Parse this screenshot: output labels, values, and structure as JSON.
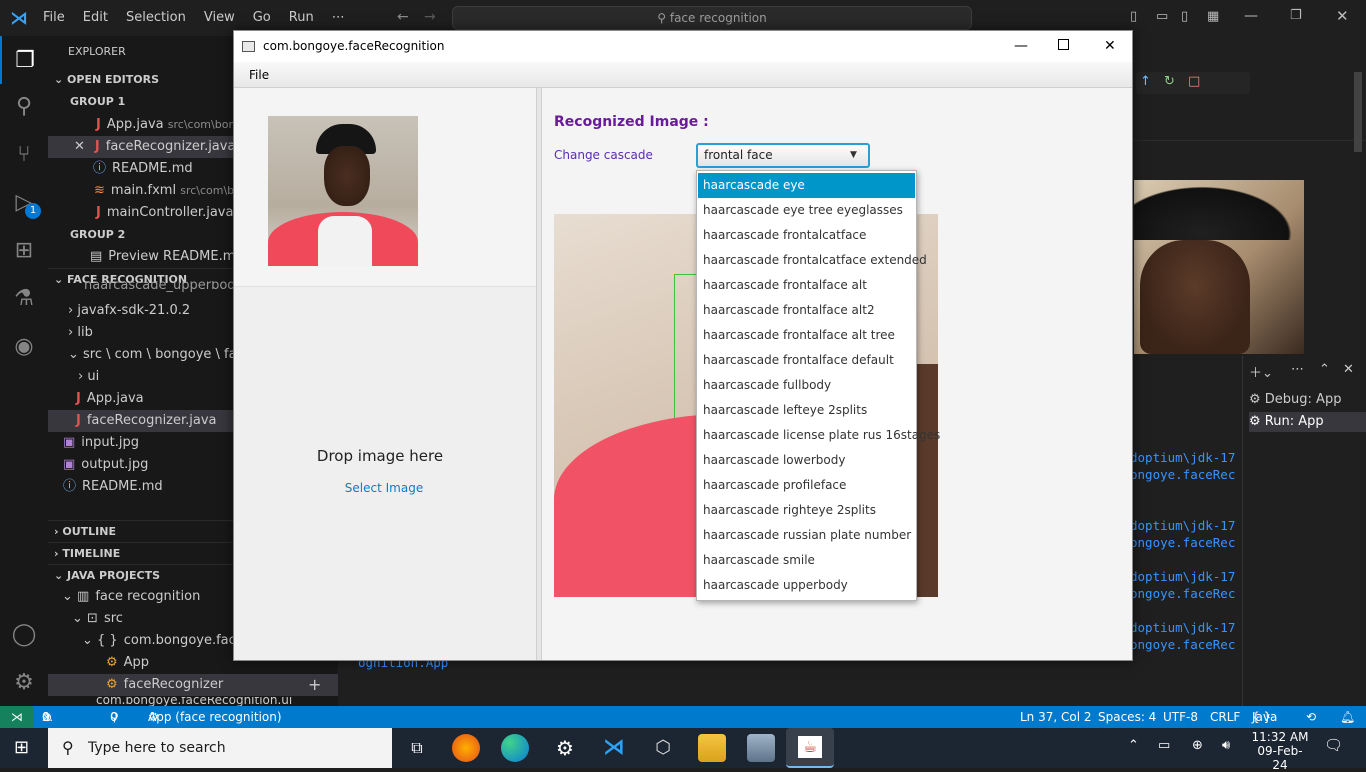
{
  "vscode": {
    "menu": [
      "File",
      "Edit",
      "Selection",
      "View",
      "Go",
      "Run",
      "⋯"
    ],
    "command_center": "face recognition",
    "debug_badge": "1"
  },
  "sidebar": {
    "explorer_title": "EXPLORER",
    "open_editors": "OPEN EDITORS",
    "group1": "GROUP 1",
    "group2": "GROUP 2",
    "open_files": [
      {
        "name": "App.java",
        "path": "src\\com\\bon"
      },
      {
        "name": "faceRecognizer.java",
        "path": "s"
      },
      {
        "name": "README.md",
        "path": ""
      },
      {
        "name": "main.fxml",
        "path": "src\\com\\bo"
      },
      {
        "name": "mainController.java",
        "path": "s"
      }
    ],
    "preview_readme": "Preview README.md",
    "project": "FACE RECOGNITION",
    "tree": {
      "cut_item": "haarcascade_upperbody.",
      "javafx": "javafx-sdk-21.0.2",
      "lib": "lib",
      "src_path": "src \\ com \\ bongoye \\ faceRe",
      "ui": "ui",
      "app_java": "App.java",
      "face_java": "faceRecognizer.java",
      "input": "input.jpg",
      "output": "output.jpg",
      "readme": "README.md"
    },
    "outline": "OUTLINE",
    "timeline": "TIMELINE",
    "java_projects": "JAVA PROJECTS",
    "jp_root": "face recognition",
    "jp_src": "src",
    "jp_pkg": "com.bongoye.faceR",
    "jp_app": "App",
    "jp_face": "faceRecognizer",
    "jp_cut": "com.bongoye.faceRecognition.ui"
  },
  "panel": {
    "debug_app": "Debug: App",
    "run_app": "Run: App",
    "lines": [
      "doptium\\jdk-17",
      "ongoye.faceRec",
      "doptium\\jdk-17",
      "ongoye.faceRec",
      "doptium\\jdk-17",
      "ongoye.faceRec",
      "doptium\\jdk-17",
      "ongoye.faceRec"
    ],
    "bottom_line": "ognition.App"
  },
  "statusbar": {
    "errors": "0",
    "warnings": "0",
    "ports": "0",
    "run_target": "App (face recognition)",
    "position": "Ln 37, Col 2",
    "spaces": "Spaces: 4",
    "encoding": "UTF-8",
    "eol": "CRLF",
    "language": "Java"
  },
  "taskbar": {
    "search_placeholder": "Type here to search",
    "time": "11:32 AM",
    "date": "09-Feb-24"
  },
  "fx": {
    "title": "com.bongoye.faceRecognition",
    "menu_file": "File",
    "drop_label": "Drop image here",
    "select_image": "Select Image",
    "recognized_title": "Recognized Image :",
    "change_cascade": "Change cascade",
    "cascade_value": "frontal face",
    "options": [
      "haarcascade eye",
      "haarcascade eye tree eyeglasses",
      "haarcascade frontalcatface",
      "haarcascade frontalcatface extended",
      "haarcascade frontalface alt",
      "haarcascade frontalface alt2",
      "haarcascade frontalface alt tree",
      "haarcascade frontalface default",
      "haarcascade fullbody",
      "haarcascade lefteye 2splits",
      "haarcascade license plate rus 16stages",
      "haarcascade lowerbody",
      "haarcascade profileface",
      "haarcascade righteye 2splits",
      "haarcascade russian plate number",
      "haarcascade smile",
      "haarcascade upperbody"
    ]
  },
  "colors": {
    "accent_blue": "#007acc",
    "fx_title_purple": "#6a1b9a",
    "dropdown_selected": "#0096c9"
  }
}
